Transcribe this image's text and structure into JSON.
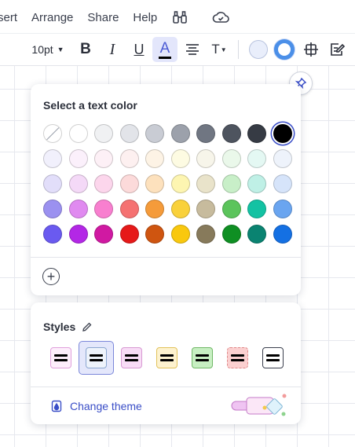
{
  "menu": {
    "items": [
      "sert",
      "Arrange",
      "Share",
      "Help"
    ],
    "icons": [
      "binoculars-icon",
      "cloud-check-icon"
    ]
  },
  "toolbar": {
    "font_size": "10pt",
    "bold_label": "B",
    "italic_label": "I",
    "underline_label": "U",
    "text_color_label": "A",
    "text_size_label": "T",
    "fill_color": "#e9eefb",
    "stroke_color": "#4b8fe8"
  },
  "color_panel": {
    "title": "Select a text color",
    "selected_color": "#000000",
    "swatches": [
      [
        "none",
        "#ffffff",
        "#f0f1f3",
        "#e2e4e9",
        "#c9ccd4",
        "#9ca1ab",
        "#707682",
        "#4e545f",
        "#363b44",
        "#000000"
      ],
      [
        "#f1f0fc",
        "#fbf0fb",
        "#fdf0f6",
        "#fdf0f0",
        "#fdf3e5",
        "#fdfbe2",
        "#f7f5ea",
        "#eaf8ea",
        "#e4f8f3",
        "#eef3fb"
      ],
      [
        "#e2defa",
        "#f4d9f7",
        "#fcd6ec",
        "#fcdada",
        "#fde1bd",
        "#fdf5b1",
        "#e9e3ca",
        "#c8efc8",
        "#bff0e6",
        "#d6e4fa"
      ],
      [
        "#9b91f0",
        "#e08af0",
        "#f87fcf",
        "#f57171",
        "#f59b3a",
        "#f9d13a",
        "#c7bb9d",
        "#5bc45b",
        "#13c2a3",
        "#6aa5f0"
      ],
      [
        "#6a5af0",
        "#b327e6",
        "#d019a2",
        "#e61919",
        "#cf5510",
        "#f9c80e",
        "#877a5b",
        "#0f8f23",
        "#0a8371",
        "#1470e3"
      ]
    ],
    "add_label": "+"
  },
  "styles_panel": {
    "title": "Styles",
    "options": [
      {
        "bg": "#fdeefb",
        "border": "#e0a0dc"
      },
      {
        "bg": "#eef3fb",
        "border": "#8ba6d0"
      },
      {
        "bg": "#f8dcf6",
        "border": "#d79ad2"
      },
      {
        "bg": "#fdf2cf",
        "border": "#e2c25a"
      },
      {
        "bg": "#c7efc2",
        "border": "#72b868"
      },
      {
        "bg": "#fbd0d0",
        "border": "#e08a8a"
      },
      {
        "bg": "#ffffff",
        "border": "#3a3f4d"
      }
    ],
    "selected_index": 1,
    "change_theme_label": "Change theme"
  },
  "colors": {
    "accent": "#3a4ec7",
    "active_tool_bg": "#e3e6fb"
  }
}
